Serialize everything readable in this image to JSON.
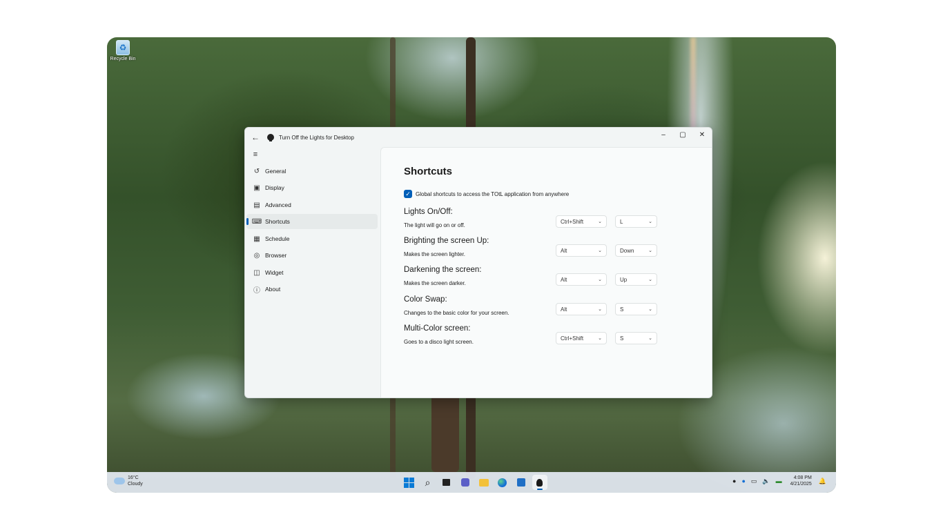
{
  "desktop": {
    "recycle_bin_label": "Recycle Bin"
  },
  "window": {
    "title": "Turn Off the Lights for Desktop",
    "back_icon": "arrow-left-icon",
    "controls": [
      "minimize",
      "maximize",
      "close"
    ]
  },
  "sidebar": {
    "items": [
      {
        "label": "General",
        "icon": "history-icon"
      },
      {
        "label": "Display",
        "icon": "display-icon"
      },
      {
        "label": "Advanced",
        "icon": "advanced-icon"
      },
      {
        "label": "Shortcuts",
        "icon": "keyboard-icon",
        "active": true
      },
      {
        "label": "Schedule",
        "icon": "calendar-icon"
      },
      {
        "label": "Browser",
        "icon": "globe-icon"
      },
      {
        "label": "Widget",
        "icon": "widget-icon"
      },
      {
        "label": "About",
        "icon": "help-icon"
      }
    ]
  },
  "main": {
    "page_title": "Shortcuts",
    "global_checkbox_label": "Global shortcuts to access the TOtL application from anywhere",
    "global_checked": true,
    "shortcuts": [
      {
        "name": "Lights On/Off:",
        "description": "The light will go on or off.",
        "modifier": "Ctrl+Shift",
        "key": "L"
      },
      {
        "name": "Brighting the screen Up:",
        "description": "Makes the screen lighter.",
        "modifier": "Alt",
        "key": "Down"
      },
      {
        "name": "Darkening the screen:",
        "description": "Makes the screen darker.",
        "modifier": "Alt",
        "key": "Up"
      },
      {
        "name": "Color Swap:",
        "description": "Changes to the basic color for your screen.",
        "modifier": "Alt",
        "key": "S"
      },
      {
        "name": "Multi-Color screen:",
        "description": "Goes to a disco light screen.",
        "modifier": "Ctrl+Shift",
        "key": "S"
      }
    ]
  },
  "taskbar": {
    "weather": {
      "temp": "16°C",
      "condition": "Cloudy"
    },
    "clock": {
      "time": "4:08 PM",
      "date": "4/21/2025"
    }
  },
  "colors": {
    "accent": "#005fb8"
  }
}
